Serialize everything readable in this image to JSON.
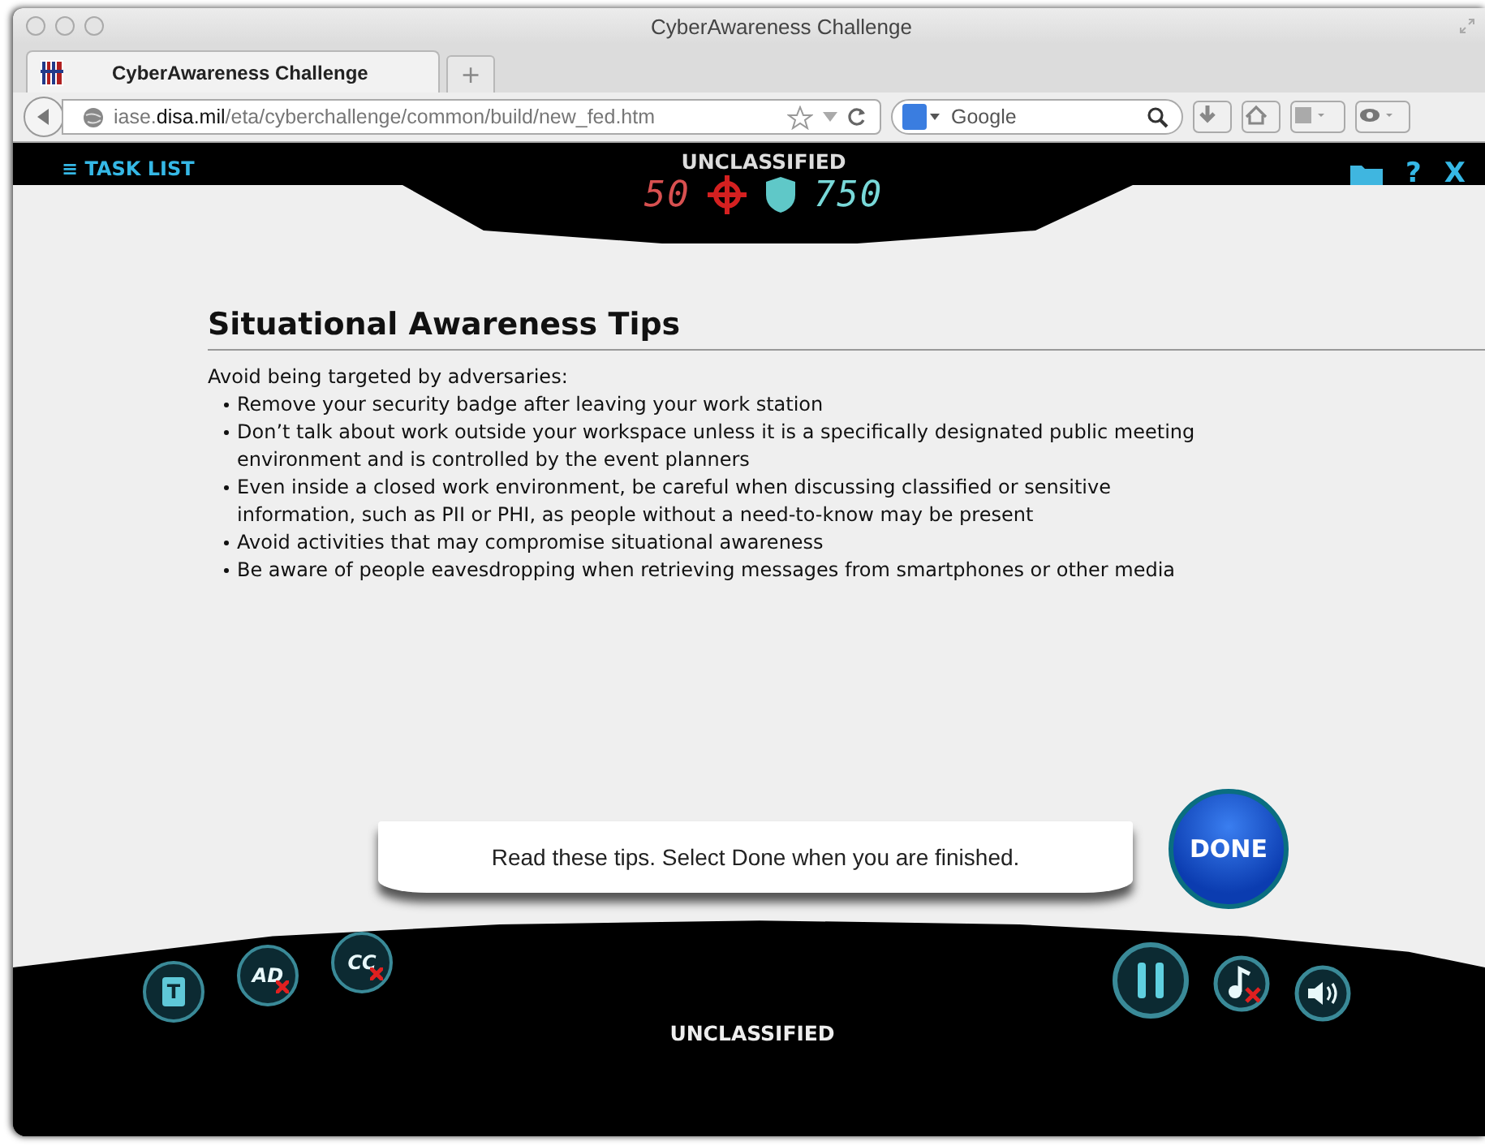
{
  "browser": {
    "window_title": "CyberAwareness Challenge",
    "tabs": [
      {
        "label": "CyberAwareness Challenge",
        "selected": true
      }
    ],
    "new_tab": "+",
    "url": "iase.**disa.mil**/eta/cyberchallenge/common/build/new_fed.htm",
    "search": {
      "placeholder": "Google"
    }
  },
  "header": {
    "task_list": "≡ TASK LIST",
    "classification": "UNCLASSIFIED",
    "threat_score": "50",
    "defense_score": "750",
    "help": "?",
    "close": "X"
  },
  "content": {
    "title": "Situational Awareness Tips",
    "intro": "Avoid being targeted by adversaries:",
    "bullets": [
      "Remove your security badge after leaving your work station",
      "Don’t talk about work outside your workspace unless it is a specifically designated public meeting environment and is controlled by the event planners",
      "Even inside a closed work environment, be careful when discussing classified or sensitive information, such as PII or PHI, as people without a need-to-know may be present",
      "Avoid activities that may compromise situational awareness",
      "Be aware of people eavesdropping when retrieving messages from smartphones or other media"
    ],
    "instruction": "Read these tips. Select Done when you are finished.",
    "done": "DONE"
  },
  "footer": {
    "left_buttons": [
      {
        "kind": "transcript",
        "label": "T",
        "off": false
      },
      {
        "kind": "audio_description",
        "label": "AD",
        "off": true
      },
      {
        "kind": "captions",
        "label": "CC",
        "off": true
      }
    ],
    "classification": "UNCLASSIFIED",
    "right_buttons": [
      {
        "kind": "pause",
        "off": false
      },
      {
        "kind": "music",
        "off": true
      },
      {
        "kind": "volume",
        "off": false
      }
    ]
  }
}
